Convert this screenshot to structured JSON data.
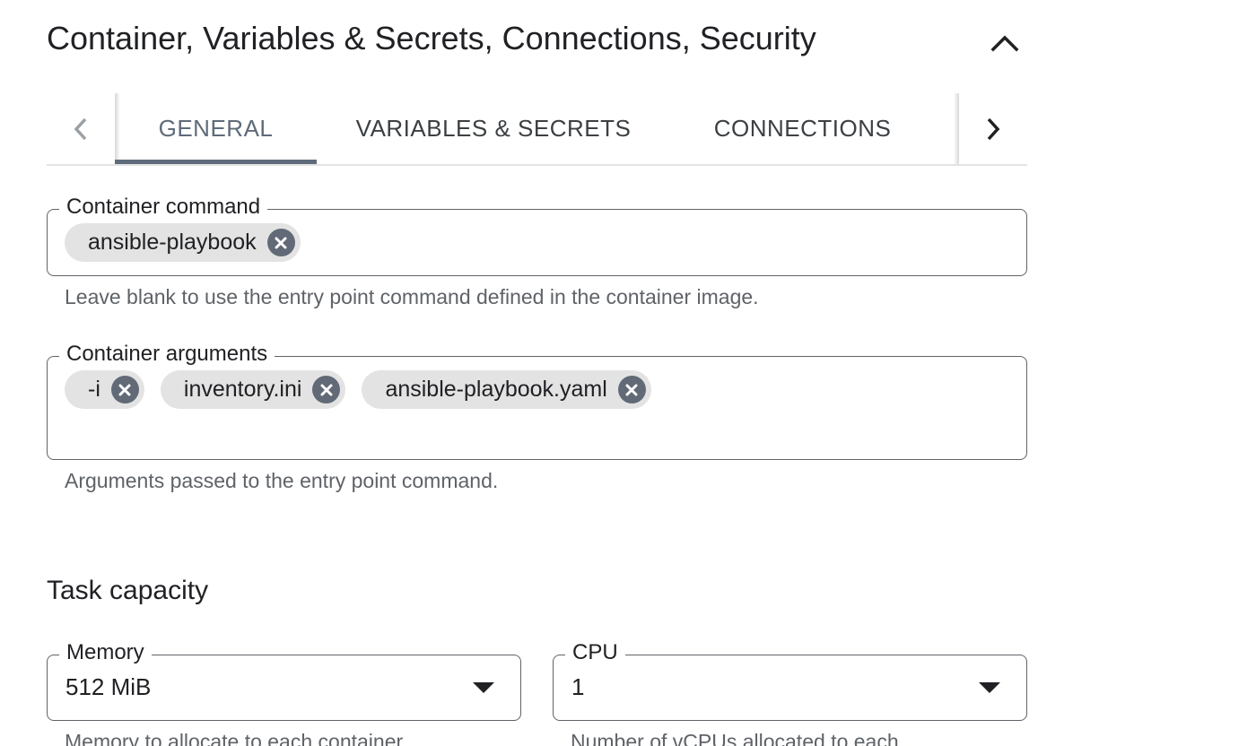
{
  "section": {
    "title": "Container, Variables & Secrets, Connections, Security",
    "collapse_icon": "chevron-up-icon"
  },
  "tabs": {
    "items": [
      {
        "label": "GENERAL",
        "active": true
      },
      {
        "label": "VARIABLES & SECRETS",
        "active": false
      },
      {
        "label": "CONNECTIONS",
        "active": false
      }
    ],
    "prev_icon": "chevron-left-icon",
    "next_icon": "chevron-right-icon"
  },
  "container_command": {
    "label": "Container command",
    "chips": [
      "ansible-playbook"
    ],
    "helper": "Leave blank to use the entry point command defined in the container image."
  },
  "container_arguments": {
    "label": "Container arguments",
    "chips": [
      "-i",
      "inventory.ini",
      "ansible-playbook.yaml"
    ],
    "helper": "Arguments passed to the entry point command."
  },
  "task_capacity": {
    "title": "Task capacity",
    "memory": {
      "label": "Memory",
      "value": "512 MiB",
      "helper": "Memory to allocate to each container"
    },
    "cpu": {
      "label": "CPU",
      "value": "1",
      "helper": "Number of vCPUs allocated to each"
    }
  },
  "colors": {
    "accent": "#5f6b7a",
    "chip_bg": "#e3e3e3",
    "chip_remove": "#616a76",
    "outline": "#5f6368"
  }
}
